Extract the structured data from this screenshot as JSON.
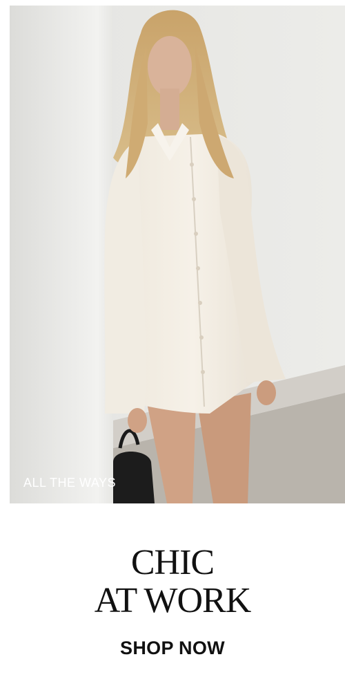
{
  "hero": {
    "caption": "ALL THE WAYS",
    "image_alt": "model-in-white-shirt-dress"
  },
  "headline": {
    "line1": "CHIC",
    "line2": "AT WORK"
  },
  "cta": {
    "label": "SHOP NOW"
  },
  "colors": {
    "text": "#111111",
    "caption": "#ffffff",
    "background": "#ffffff"
  }
}
